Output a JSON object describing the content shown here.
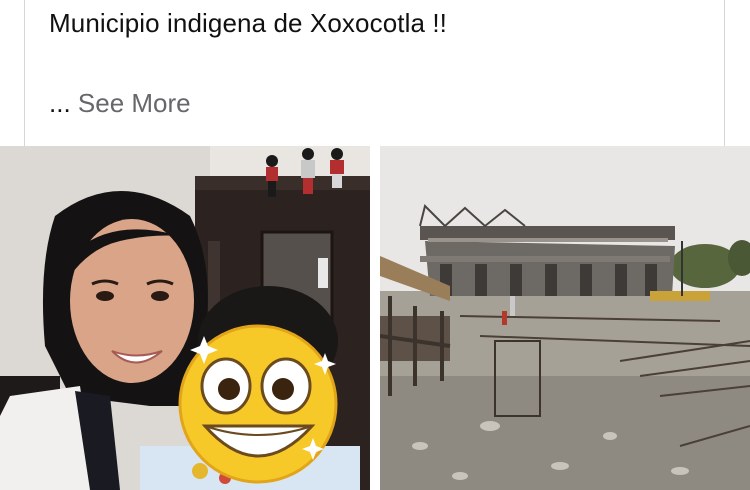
{
  "post": {
    "text": "Municipio indigena de Xoxocotla !!",
    "ellipsis": "...",
    "see_more_label": "See More"
  },
  "photos": [
    {
      "icon": "photo-selfie-with-emoji-face"
    },
    {
      "icon": "photo-building-construction-site"
    }
  ],
  "colors": {
    "link_gray": "#65676b",
    "text": "#111111",
    "card_border": "#d7d7d7"
  }
}
